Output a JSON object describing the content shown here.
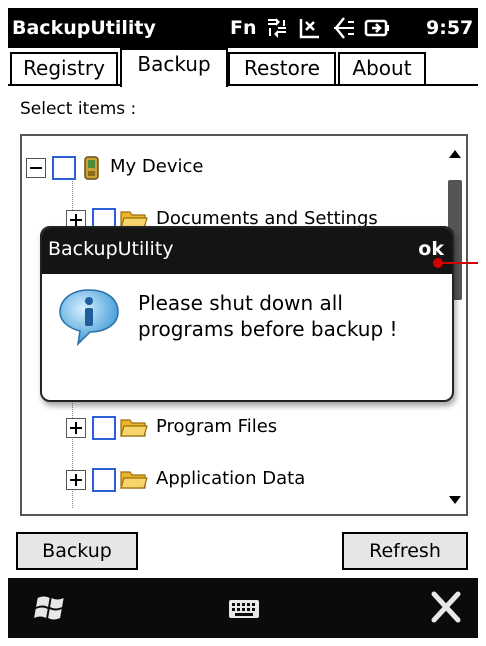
{
  "statusbar": {
    "app_title": "BackupUtility",
    "fn_label": "Fn",
    "time": "9:57",
    "icons": [
      "network-sync-icon",
      "signal-icon",
      "volume-icon",
      "battery-icon"
    ]
  },
  "tabs": [
    {
      "label": "Registry",
      "active": false
    },
    {
      "label": "Backup",
      "active": true
    },
    {
      "label": "Restore",
      "active": false
    },
    {
      "label": "About",
      "active": false
    }
  ],
  "select_label": "Select items :",
  "tree": {
    "items": [
      {
        "label": "My Device",
        "expander": "minus",
        "icon": "device-icon"
      },
      {
        "label": "Documents and Settings",
        "expander": "plus",
        "icon": "folder-icon"
      },
      {
        "label": "Program Files",
        "expander": "plus",
        "icon": "folder-icon"
      },
      {
        "label": "Application Data",
        "expander": "plus",
        "icon": "folder-icon"
      }
    ]
  },
  "dialog": {
    "title": "BackupUtility",
    "ok_label": "ok",
    "message_line1": "Please shut down all",
    "message_line2": "programs before backup !",
    "icon": "info-icon"
  },
  "buttons": {
    "backup_label": "Backup",
    "refresh_label": "Refresh"
  },
  "bottombar": {
    "icons": [
      "windows-start-icon",
      "keyboard-icon",
      "close-icon"
    ]
  },
  "colors": {
    "checkbox_border": "#2e5fd8",
    "folder": "#f2c338",
    "callout": "#d40000"
  }
}
